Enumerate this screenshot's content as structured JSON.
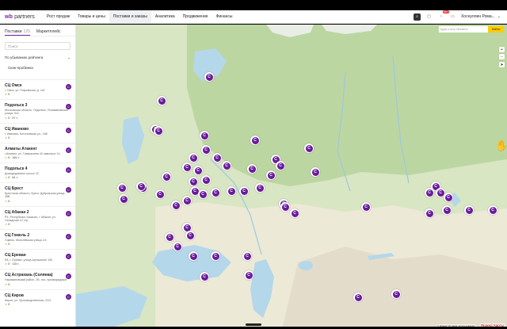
{
  "header": {
    "logo_wb": "wb",
    "logo_partners": "partners",
    "nav": [
      {
        "label": "Рост продаж",
        "active": false
      },
      {
        "label": "Товары и цены",
        "active": false
      },
      {
        "label": "Поставки и заказы",
        "active": true
      },
      {
        "label": "Аналитика",
        "active": false
      },
      {
        "label": "Продвижение",
        "active": false
      },
      {
        "label": "Финансы",
        "active": false
      }
    ],
    "notif_count": "99+",
    "user_name": "Хоснуллин Рома...",
    "icons": [
      "search-icon",
      "document-icon",
      "bell-icon",
      "chat-icon"
    ]
  },
  "sidebar": {
    "tabs": [
      {
        "label": "Поставки",
        "count": "120",
        "active": true
      },
      {
        "label": "Маркетплейс",
        "count": "",
        "active": false
      }
    ],
    "search_placeholder": "Поиск",
    "sort_label": "По убыванию рейтинга",
    "scan_label": "Скан-пробежка",
    "warehouses": [
      {
        "name": "СЦ Омск",
        "addr": "г. Омск, ул. Покровская, д. 1к3",
        "rating": "5"
      },
      {
        "name": "Подольск 3",
        "addr": "Московская область, Подольск, Поливановская улица, 9с3",
        "rating": "5 · 57 т."
      },
      {
        "name": "СЦ Иваново",
        "addr": "г. Иваново, Бегичевская ул., 18б",
        "rating": "5"
      },
      {
        "name": "Алматы Атакент",
        "addr": "г.Алматы, ул. Тимирязева 42 павильон 7а",
        "rating": "5 · 169 т."
      },
      {
        "name": "Подольск 4",
        "addr": "Домодедовское шоссе 22",
        "rating": "5 · 84 т."
      },
      {
        "name": "СЦ Брест",
        "addr": "Брестская область, Брест, Дубровская улица, 36В",
        "rating": "5"
      },
      {
        "name": "СЦ Абакан 2",
        "addr": "РХ, Республика Хакасия, г. Абакан, ул. Складская 12 стр.",
        "rating": "5"
      },
      {
        "name": "СЦ Гомель 2",
        "addr": "Гомель, Могилёвская улица 1/4",
        "rating": "5"
      },
      {
        "name": "СЦ Ереван",
        "addr": "РА, г. Ереван, улица Арташисян 106",
        "rating": "5 · 115 т."
      },
      {
        "name": "СЦ Астрахань (Солянка)",
        "addr": "Наримановский район, 2В, пос. промзарядный",
        "rating": "5"
      },
      {
        "name": "СЦ Киров",
        "addr": "Киров, ул. Производственная, 22/4",
        "rating": "5"
      }
    ]
  },
  "map": {
    "goto_placeholder": "Куда я хочу обновить",
    "goto_button": "Найти",
    "zoom_in": "+",
    "zoom_out": "−",
    "locate": "➤",
    "marker_letter": "C",
    "attribution": "Яндекс Карты",
    "terms": "© Яндекс  Условия использования",
    "colors": {
      "water": "#b4d7ea",
      "land": "#d8e6c3",
      "forest": "#bcd6a2",
      "steppe": "#ece9d6",
      "mountain": "#e4dccb",
      "marker": "#6a1b9a"
    }
  }
}
